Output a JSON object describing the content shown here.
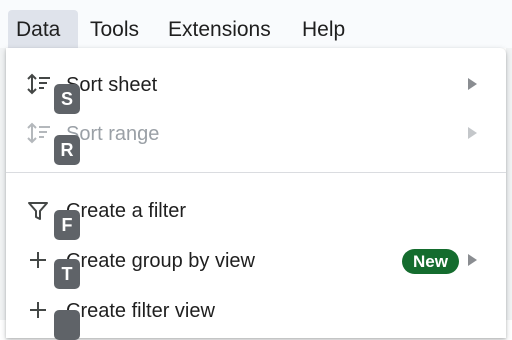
{
  "menubar": {
    "items": [
      {
        "label": "Data",
        "active": true
      },
      {
        "label": "Tools"
      },
      {
        "label": "Extensions"
      },
      {
        "label": "Help"
      }
    ]
  },
  "dropdown": {
    "items": [
      {
        "label": "Sort sheet",
        "icon": "sort-icon",
        "shortcut": "S",
        "submenu": true,
        "disabled": false
      },
      {
        "label": "Sort range",
        "icon": "sort-icon",
        "shortcut": "R",
        "submenu": true,
        "disabled": true
      },
      {
        "label": "Create a filter",
        "icon": "filter-icon",
        "shortcut": "F",
        "submenu": false,
        "disabled": false
      },
      {
        "label": "Create group by view",
        "icon": "plus-icon",
        "shortcut": "T",
        "submenu": true,
        "badge": "New",
        "disabled": false
      },
      {
        "label": "Create filter view",
        "icon": "plus-icon",
        "submenu": false,
        "disabled": false
      }
    ]
  },
  "colors": {
    "badge_green": "#146c2e",
    "shortcut_badge": "#5f6368",
    "menubar_active": "#dfe3eb"
  }
}
